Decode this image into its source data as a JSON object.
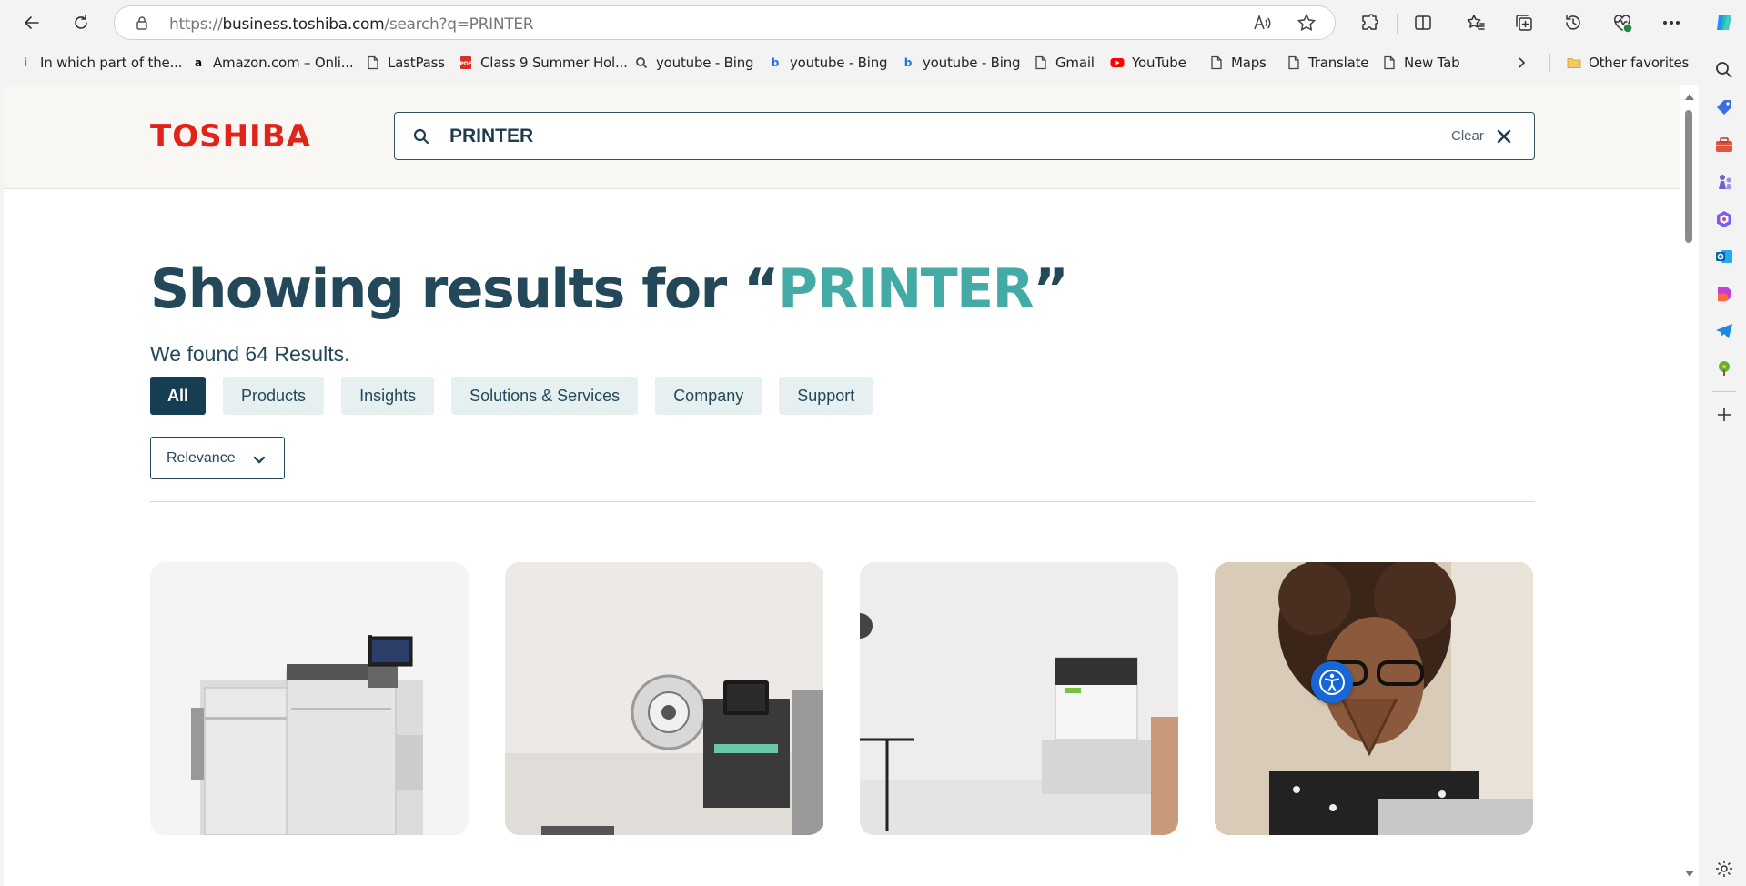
{
  "browser": {
    "url_prefix": "https://",
    "url_host": "business.toshiba.com",
    "url_path": "/search?q=PRINTER",
    "bookmarks": [
      {
        "label": "In which part of the...",
        "icon": "microsoft-start-icon"
      },
      {
        "label": "Amazon.com – Onli...",
        "icon": "amazon-icon"
      },
      {
        "label": "LastPass",
        "icon": "page-icon"
      },
      {
        "label": "Class 9 Summer Hol...",
        "icon": "pdf-icon"
      },
      {
        "label": "youtube - Bing",
        "icon": "search-icon"
      },
      {
        "label": "youtube - Bing",
        "icon": "bing-icon"
      },
      {
        "label": "youtube - Bing",
        "icon": "bing-icon"
      },
      {
        "label": "Gmail",
        "icon": "page-icon"
      },
      {
        "label": "YouTube",
        "icon": "youtube-icon"
      },
      {
        "label": "Maps",
        "icon": "page-icon"
      },
      {
        "label": "Translate",
        "icon": "page-icon"
      },
      {
        "label": "New Tab",
        "icon": "page-icon"
      }
    ],
    "other_favorites": "Other favorites"
  },
  "header": {
    "logo": "TOSHIBA",
    "search_value": "PRINTER",
    "clear_label": "Clear"
  },
  "results": {
    "title_prefix": "Showing results for “",
    "query": "PRINTER",
    "title_suffix": "”",
    "count_text": "We found 64 Results."
  },
  "filters": {
    "tabs": [
      "All",
      "Products",
      "Insights",
      "Solutions & Services",
      "Company",
      "Support"
    ],
    "active": "All",
    "sort_label": "Relevance"
  },
  "colors": {
    "brand_red": "#e2231a",
    "navy": "#22485a",
    "teal": "#44aaa5",
    "tab_bg": "#e7f0f0",
    "active_tab": "#153e52",
    "accessibility_blue": "#1666d8"
  }
}
